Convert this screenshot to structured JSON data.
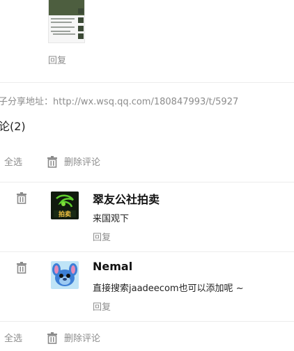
{
  "top_post": {
    "reply_label": "回复"
  },
  "share": {
    "text": "子分享地址：http://wx.wsq.qq.com/180847993/t/5927"
  },
  "comments_heading": "论(2)",
  "toolbar_top": {
    "select_all": "全选",
    "delete_comments": "删除评论"
  },
  "comments": [
    {
      "name": "翠友公社拍卖",
      "text": "来国观下",
      "reply_label": "回复",
      "avatar_text": "拍卖"
    },
    {
      "name": "Nemal",
      "text": "直接搜索jaadeecom也可以添加呢 ~",
      "reply_label": "回复"
    }
  ],
  "toolbar_bottom": {
    "select_all": "全选",
    "delete_comments": "删除评论"
  },
  "colors": {
    "muted_text": "#8c8c8c",
    "divider": "#ececec",
    "trash_icon": "#8a8a8a"
  }
}
